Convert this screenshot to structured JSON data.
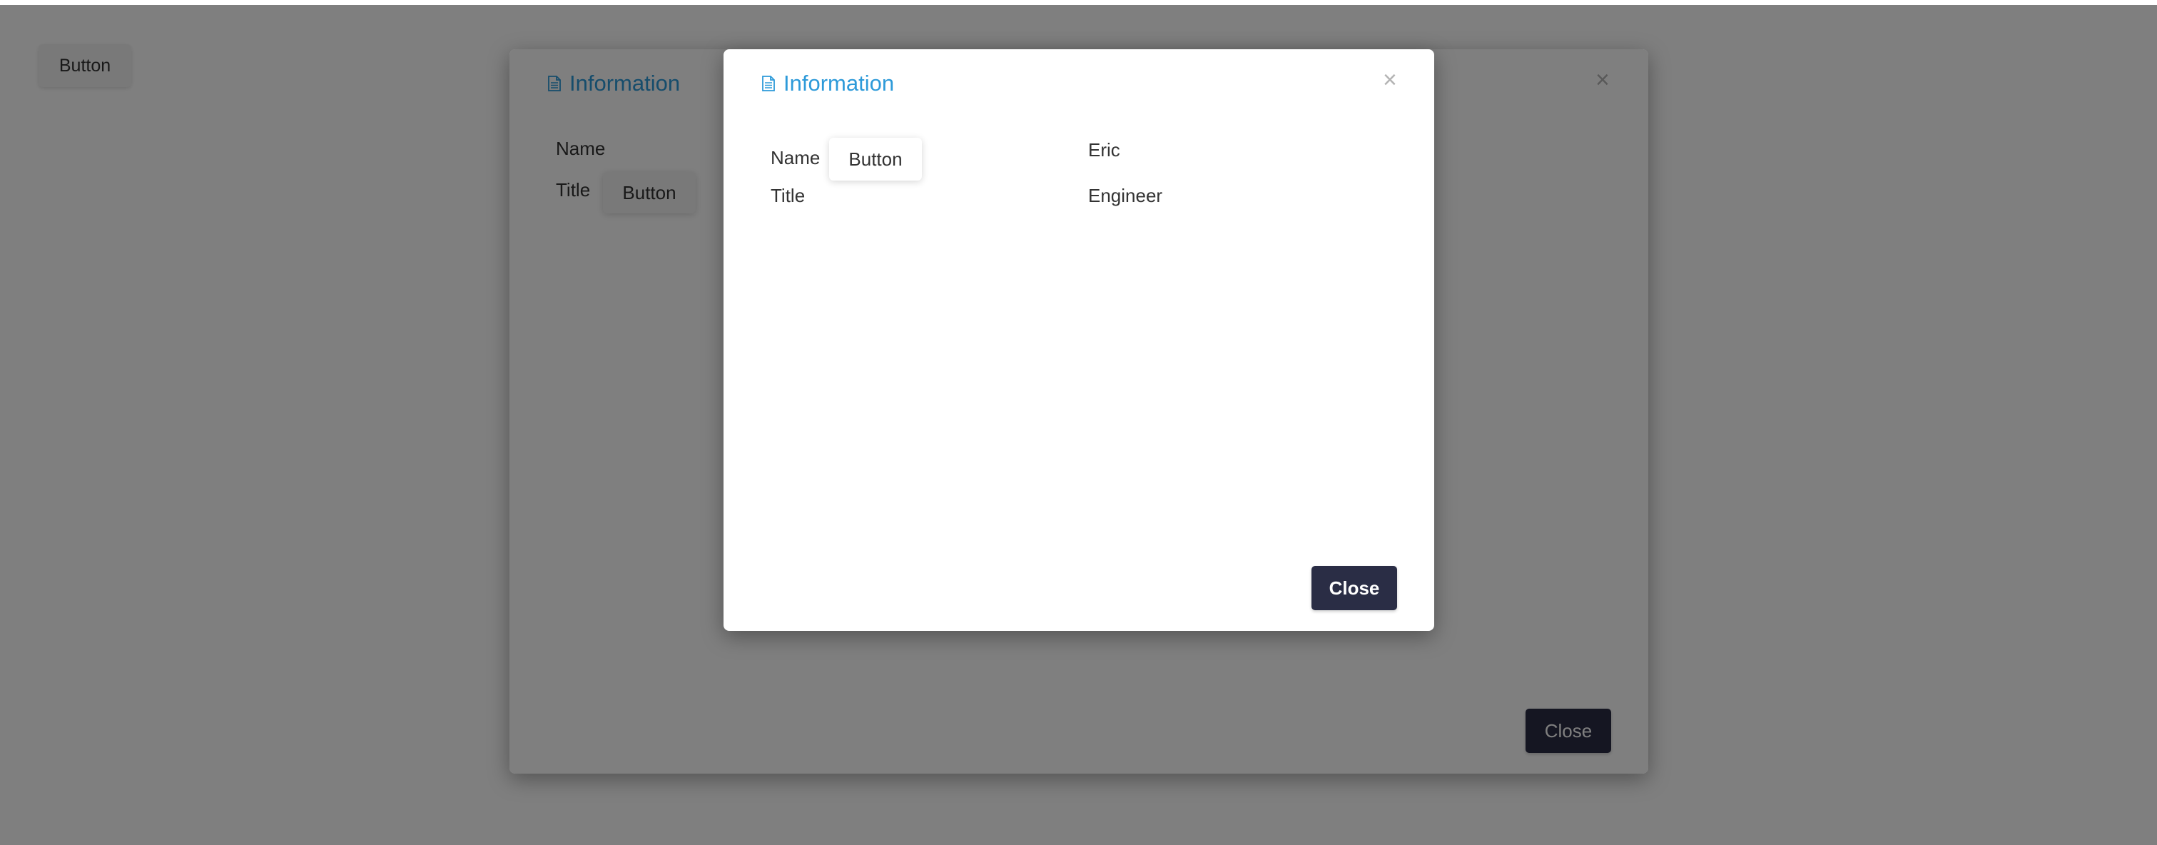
{
  "page": {
    "button_label": "Button"
  },
  "back_modal": {
    "title": "Information",
    "close_symbol": "×",
    "fields": {
      "name_label": "Name",
      "title_label": "Title"
    },
    "title_button_label": "Button",
    "close_button_label": "Close"
  },
  "front_modal": {
    "title": "Information",
    "close_symbol": "×",
    "fields": {
      "name_label": "Name",
      "name_value": "Eric",
      "title_label": "Title",
      "title_value": "Engineer"
    },
    "name_button_label": "Button",
    "close_button_label": "Close"
  },
  "icons": {
    "title_icon": "document-icon",
    "close_icon": "close-icon"
  },
  "colors": {
    "accent": "#2d9ad9",
    "primary_button": "#2a2d45",
    "overlay": "rgba(0,0,0,0.5)"
  }
}
